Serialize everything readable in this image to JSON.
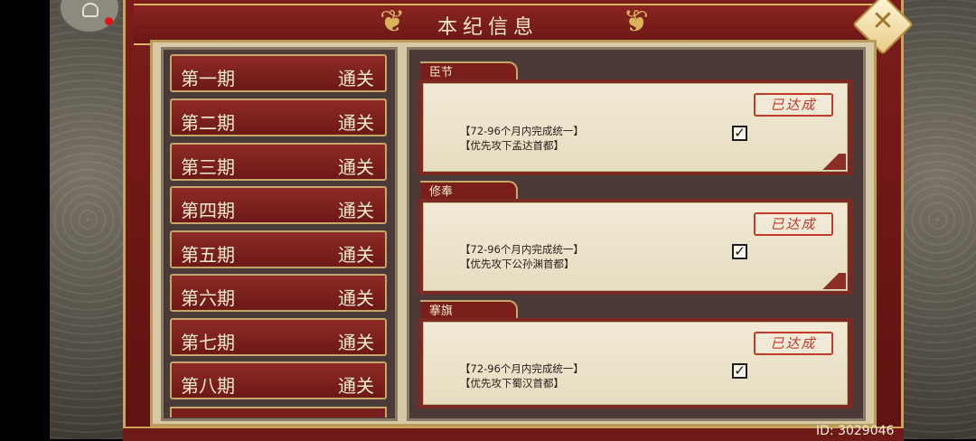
{
  "header": {
    "title": "本纪信息",
    "close_icon": "close-x-icon"
  },
  "periods": [
    {
      "name": "第一期",
      "status": "通关"
    },
    {
      "name": "第二期",
      "status": "通关"
    },
    {
      "name": "第三期",
      "status": "通关"
    },
    {
      "name": "第四期",
      "status": "通关"
    },
    {
      "name": "第五期",
      "status": "通关"
    },
    {
      "name": "第六期",
      "status": "通关"
    },
    {
      "name": "第七期",
      "status": "通关"
    },
    {
      "name": "第八期",
      "status": "通关"
    }
  ],
  "objectives": [
    {
      "tab": "臣节",
      "stamp": "已达成",
      "line1": "【72-96个月内完成统一】",
      "line2": "【优先攻下孟达首都】",
      "checked": true
    },
    {
      "tab": "修奉",
      "stamp": "已达成",
      "line1": "【72-96个月内完成统一】",
      "line2": "【优先攻下公孙渊首都】",
      "checked": true
    },
    {
      "tab": "搴旗",
      "stamp": "已达成",
      "line1": "【72-96个月内完成统一】",
      "line2": "【优先攻下蜀汉首都】",
      "checked": true
    }
  ],
  "footer": {
    "id_text": "ID: 3029046"
  },
  "colors": {
    "frame_red": "#7b1d1a",
    "gold": "#c9a45a",
    "stamp_red": "#c13a2a"
  }
}
